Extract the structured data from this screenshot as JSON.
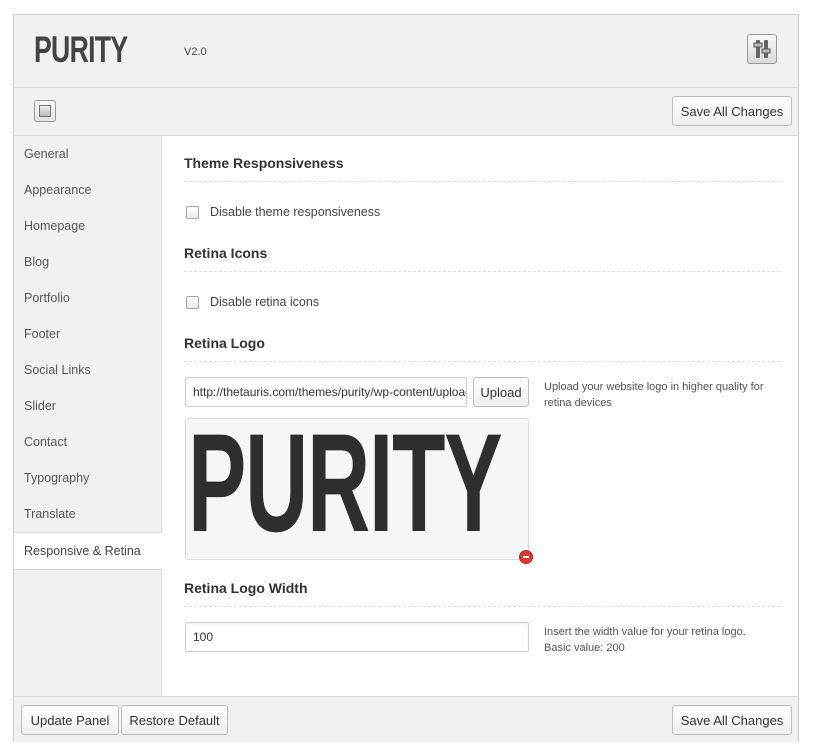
{
  "header": {
    "logo": "PURITY",
    "version": "V2.0",
    "settings_icon": "sliders-icon"
  },
  "toolbar": {
    "toggle_icon": "panel-toggle-icon",
    "save_label": "Save All Changes"
  },
  "sidebar": {
    "items": [
      {
        "label": "General",
        "active": false
      },
      {
        "label": "Appearance",
        "active": false
      },
      {
        "label": "Homepage",
        "active": false
      },
      {
        "label": "Blog",
        "active": false
      },
      {
        "label": "Portfolio",
        "active": false
      },
      {
        "label": "Footer",
        "active": false
      },
      {
        "label": "Social Links",
        "active": false
      },
      {
        "label": "Slider",
        "active": false
      },
      {
        "label": "Contact",
        "active": false
      },
      {
        "label": "Typography",
        "active": false
      },
      {
        "label": "Translate",
        "active": false
      },
      {
        "label": "Responsive & Retina",
        "active": true
      }
    ]
  },
  "main": {
    "theme_responsiveness": {
      "title": "Theme Responsiveness",
      "checkbox_label": "Disable theme responsiveness",
      "checked": false
    },
    "retina_icons": {
      "title": "Retina Icons",
      "checkbox_label": "Disable retina icons",
      "checked": false
    },
    "retina_logo": {
      "title": "Retina Logo",
      "url_value": "http://thetauris.com/themes/purity/wp-content/uploads",
      "upload_label": "Upload",
      "help": "Upload your website logo in higher quality for retina devices",
      "preview_text": "PURITY",
      "remove_icon": "remove-icon"
    },
    "retina_logo_width": {
      "title": "Retina Logo Width",
      "value": "100",
      "help_line1": "Insert the width value for your retina logo.",
      "help_line2": "Basic value: 200"
    }
  },
  "footer": {
    "update_label": "Update Panel",
    "restore_label": "Restore Default",
    "save_label": "Save All Changes"
  },
  "colors": {
    "panel_bg": "#f1f1f1",
    "remove_red": "#d9392f"
  }
}
